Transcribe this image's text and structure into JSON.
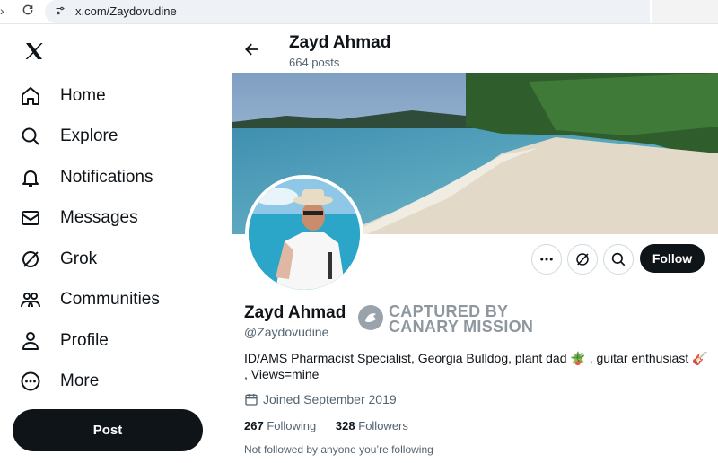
{
  "browser": {
    "url": "x.com/Zaydovudine",
    "icons": [
      "forward-arrow-icon",
      "reload-icon",
      "site-settings-icon"
    ]
  },
  "sidebar": {
    "logo": "x-logo",
    "items": [
      {
        "label": "Home",
        "icon": "home-icon"
      },
      {
        "label": "Explore",
        "icon": "search-icon"
      },
      {
        "label": "Notifications",
        "icon": "bell-icon"
      },
      {
        "label": "Messages",
        "icon": "envelope-icon"
      },
      {
        "label": "Grok",
        "icon": "grok-icon"
      },
      {
        "label": "Communities",
        "icon": "communities-icon"
      },
      {
        "label": "Profile",
        "icon": "person-icon"
      },
      {
        "label": "More",
        "icon": "more-circle-icon"
      }
    ],
    "post_label": "Post"
  },
  "header": {
    "name": "Zayd Ahmad",
    "posts": "664 posts"
  },
  "profile": {
    "name": "Zayd Ahmad",
    "handle": "@Zaydovudine",
    "bio_line1": "ID/AMS Pharmacist Specialist, Georgia Bulldog, plant dad 🪴 , guitar enthusiast 🎸",
    "bio_line2": ", Views=mine",
    "joined": "Joined September 2019",
    "following_count": "267",
    "following_label": "Following",
    "followers_count": "328",
    "followers_label": "Followers",
    "not_followed": "Not followed by anyone you’re following",
    "follow_label": "Follow"
  },
  "stamp": {
    "line1": "CAPTURED BY",
    "line2": "CANARY MISSION"
  },
  "colors": {
    "text": "#0f1419",
    "muted": "#536471",
    "border": "#cfd9de",
    "button_dark": "#0f1419"
  }
}
